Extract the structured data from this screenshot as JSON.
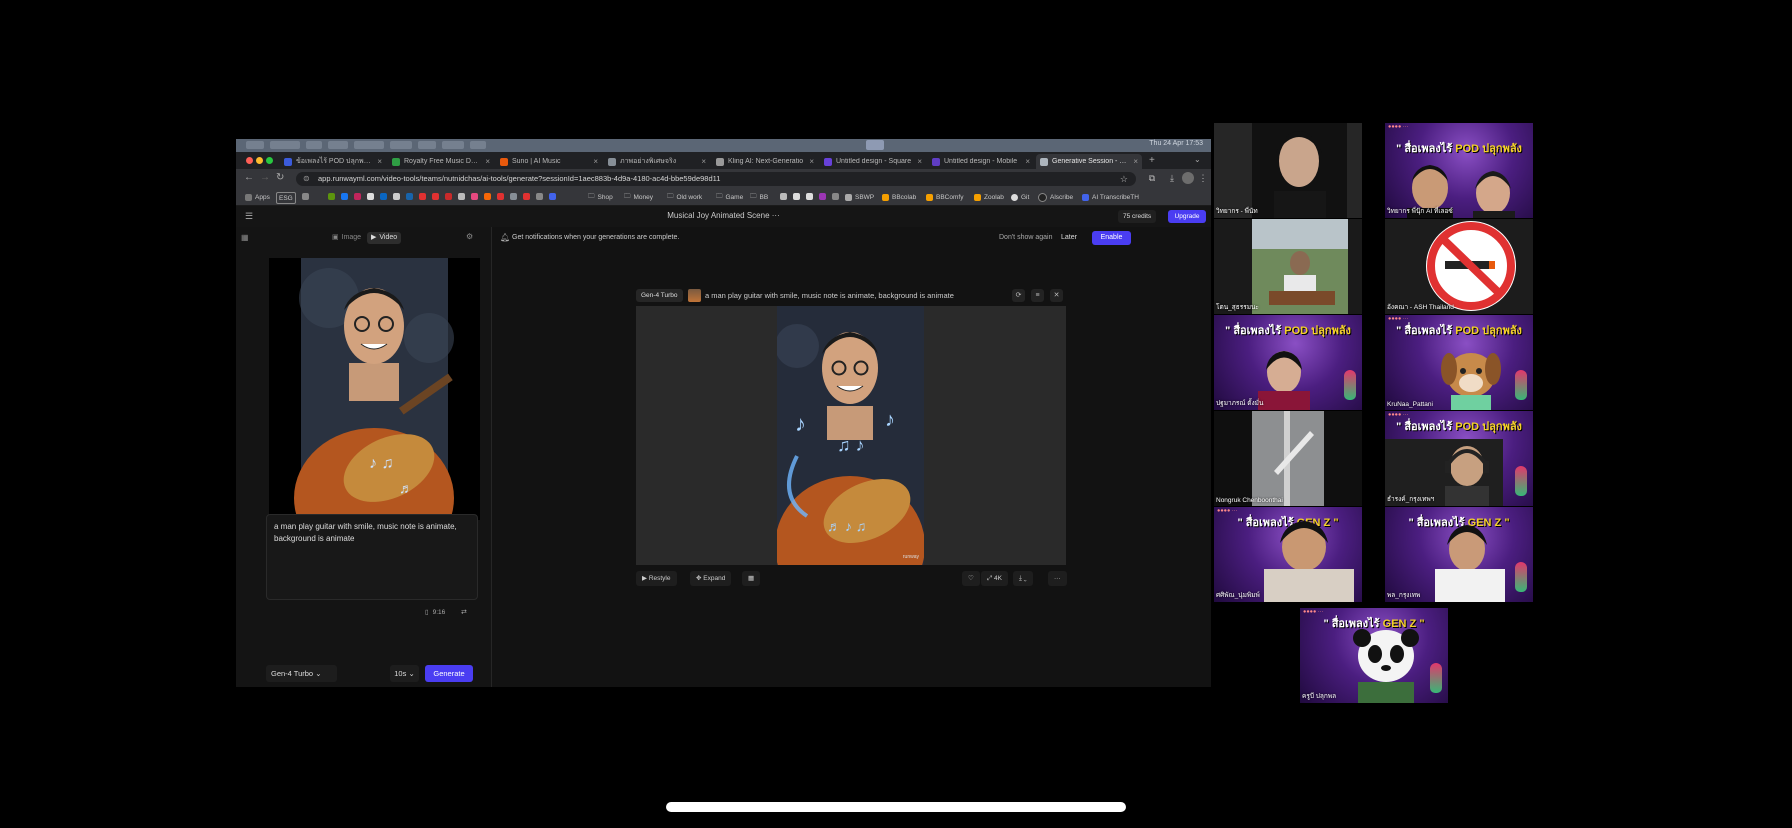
{
  "mac_menubar": {
    "clock": "Thu 24 Apr 17:53"
  },
  "browser": {
    "tabs": [
      {
        "title": "ข้อเพลงไร้ POD ปลุกพลัง GEN",
        "color": "#3b5bdb",
        "active": false
      },
      {
        "title": "Royalty Free Music Down",
        "color": "#2f9e44",
        "active": false
      },
      {
        "title": "Suno | AI Music",
        "color": "#e8590c",
        "active": false
      },
      {
        "title": "ภาพอย่างพิเศษจริง",
        "color": "#868e96",
        "active": false
      },
      {
        "title": "Kling AI: Next-Generatio",
        "color": "#999999",
        "active": false
      },
      {
        "title": "Untitled design - Square",
        "color": "#6741d9",
        "active": false
      },
      {
        "title": "Untitled design - Mobile",
        "color": "#5f3dc4",
        "active": false
      },
      {
        "title": "Generative Session - Run",
        "color": "#adb5bd",
        "active": true
      }
    ],
    "url": "app.runwayml.com/video-tools/teams/nutnidchas/ai-tools/generate?sessionId=1aec883b-4d9a-4180-ac4d-bbe59de98d11",
    "bookmarks": [
      "Apps",
      "ESG",
      "Shop",
      "Money",
      "Old work",
      "Game",
      "BB",
      "SBWP",
      "BBcolab",
      "BBComfy",
      "Zoolab",
      "Git",
      "Alscribe",
      "AI TranscribeTH"
    ]
  },
  "runway": {
    "project_title": "Musical Joy Animated Scene ···",
    "credits": "75 credits",
    "upgrade": "Upgrade",
    "modes": {
      "image": "Image",
      "video": "Video",
      "selected": "Video"
    },
    "prompt": "a man play guitar with smile, music note is animate, background is animate",
    "aspect_ratio": "9:16",
    "model": "Gen-4 Turbo",
    "duration": "10s",
    "generate": "Generate",
    "notification": {
      "text": "Get notifications when your generations are complete.",
      "dont_show": "Don't show again",
      "later": "Later",
      "enable": "Enable"
    },
    "generation": {
      "model_tag": "Gen-4 Turbo",
      "prompt": "a man play guitar with smile, music note is animate, background is animate",
      "watermark": "runway"
    },
    "actions": {
      "restyle": "Restyle",
      "expand": "Expand",
      "upscale": "4K"
    }
  },
  "participants": [
    {
      "name": "วิทยากร - พี่นัท",
      "kind": "camera-dark"
    },
    {
      "name": "วิทยากร พี่นุ๊ก AI ที่เลอซ์",
      "kind": "banner-kids"
    },
    {
      "name": "โตน_สุธรรมนะ",
      "kind": "camera-field"
    },
    {
      "name": "อังคณา - ASH Thailand",
      "kind": "no-smoking"
    },
    {
      "name": "ปฐมาภรณ์ ตั้งมั่น",
      "kind": "banner-woman"
    },
    {
      "name": "KruNaa_Pattani",
      "kind": "banner-dog"
    },
    {
      "name": "Nongruk Chenboonthai",
      "kind": "camera-ceiling"
    },
    {
      "name": "ธำรงค์_กรุงเทพฯ",
      "kind": "banner-man-headset"
    },
    {
      "name": "ศศิพัณ_นุ่มพิมพ์",
      "kind": "banner-boy"
    },
    {
      "name": "พล_กรุงเทพ",
      "kind": "banner-man"
    },
    {
      "name": "ครูบี ปลุกพล",
      "kind": "banner-panda"
    }
  ],
  "zoom_banner": {
    "prefix": "\" สื่อเพลงไร้ ",
    "pod": "POD",
    "middle": " ปลุกพลัง ",
    "genz": "GEN Z \""
  }
}
